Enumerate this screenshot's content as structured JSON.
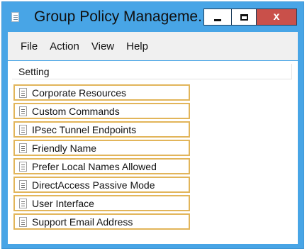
{
  "window": {
    "title": "Group Policy Manageme...",
    "controls": {
      "minimize": "minimize-icon",
      "maximize": "maximize-icon",
      "close": "close-icon",
      "close_glyph": "x"
    }
  },
  "menu": [
    "File",
    "Action",
    "View",
    "Help"
  ],
  "table": {
    "header": "Setting",
    "rows": [
      "Corporate Resources",
      "Custom Commands",
      "IPsec Tunnel Endpoints",
      "Friendly Name",
      "Prefer Local Names Allowed",
      "DirectAccess Passive Mode",
      "User Interface",
      "Support Email Address"
    ]
  },
  "colors": {
    "titlebar": "#48a5e6",
    "close_button": "#c9504a",
    "row_outline": "#e2b55a"
  }
}
